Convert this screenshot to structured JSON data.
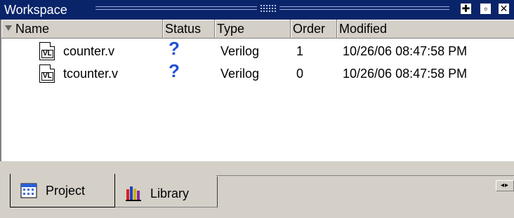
{
  "window": {
    "title": "Workspace",
    "buttons": {
      "dock": "✚",
      "restore": "▫",
      "close": "✕"
    }
  },
  "columns": {
    "name": "Name",
    "status": "Status",
    "type": "Type",
    "order": "Order",
    "modified": "Modified"
  },
  "rows": [
    {
      "icon": "verilog-file-icon",
      "icon_text": "VL",
      "name": "counter.v",
      "status": "?",
      "type": "Verilog",
      "order": "1",
      "modified": "10/26/06 08:47:58 PM"
    },
    {
      "icon": "verilog-file-icon",
      "icon_text": "VL",
      "name": "tcounter.v",
      "status": "?",
      "type": "Verilog",
      "order": "0",
      "modified": "10/26/06 08:47:58 PM"
    }
  ],
  "tabs": [
    {
      "label": "Project",
      "icon": "project-icon",
      "active": true
    },
    {
      "label": "Library",
      "icon": "library-icon",
      "active": false
    }
  ],
  "colors": {
    "titlebar": "#0a246a",
    "status_icon": "#1e4fd6",
    "panel": "#d4d0c8"
  }
}
